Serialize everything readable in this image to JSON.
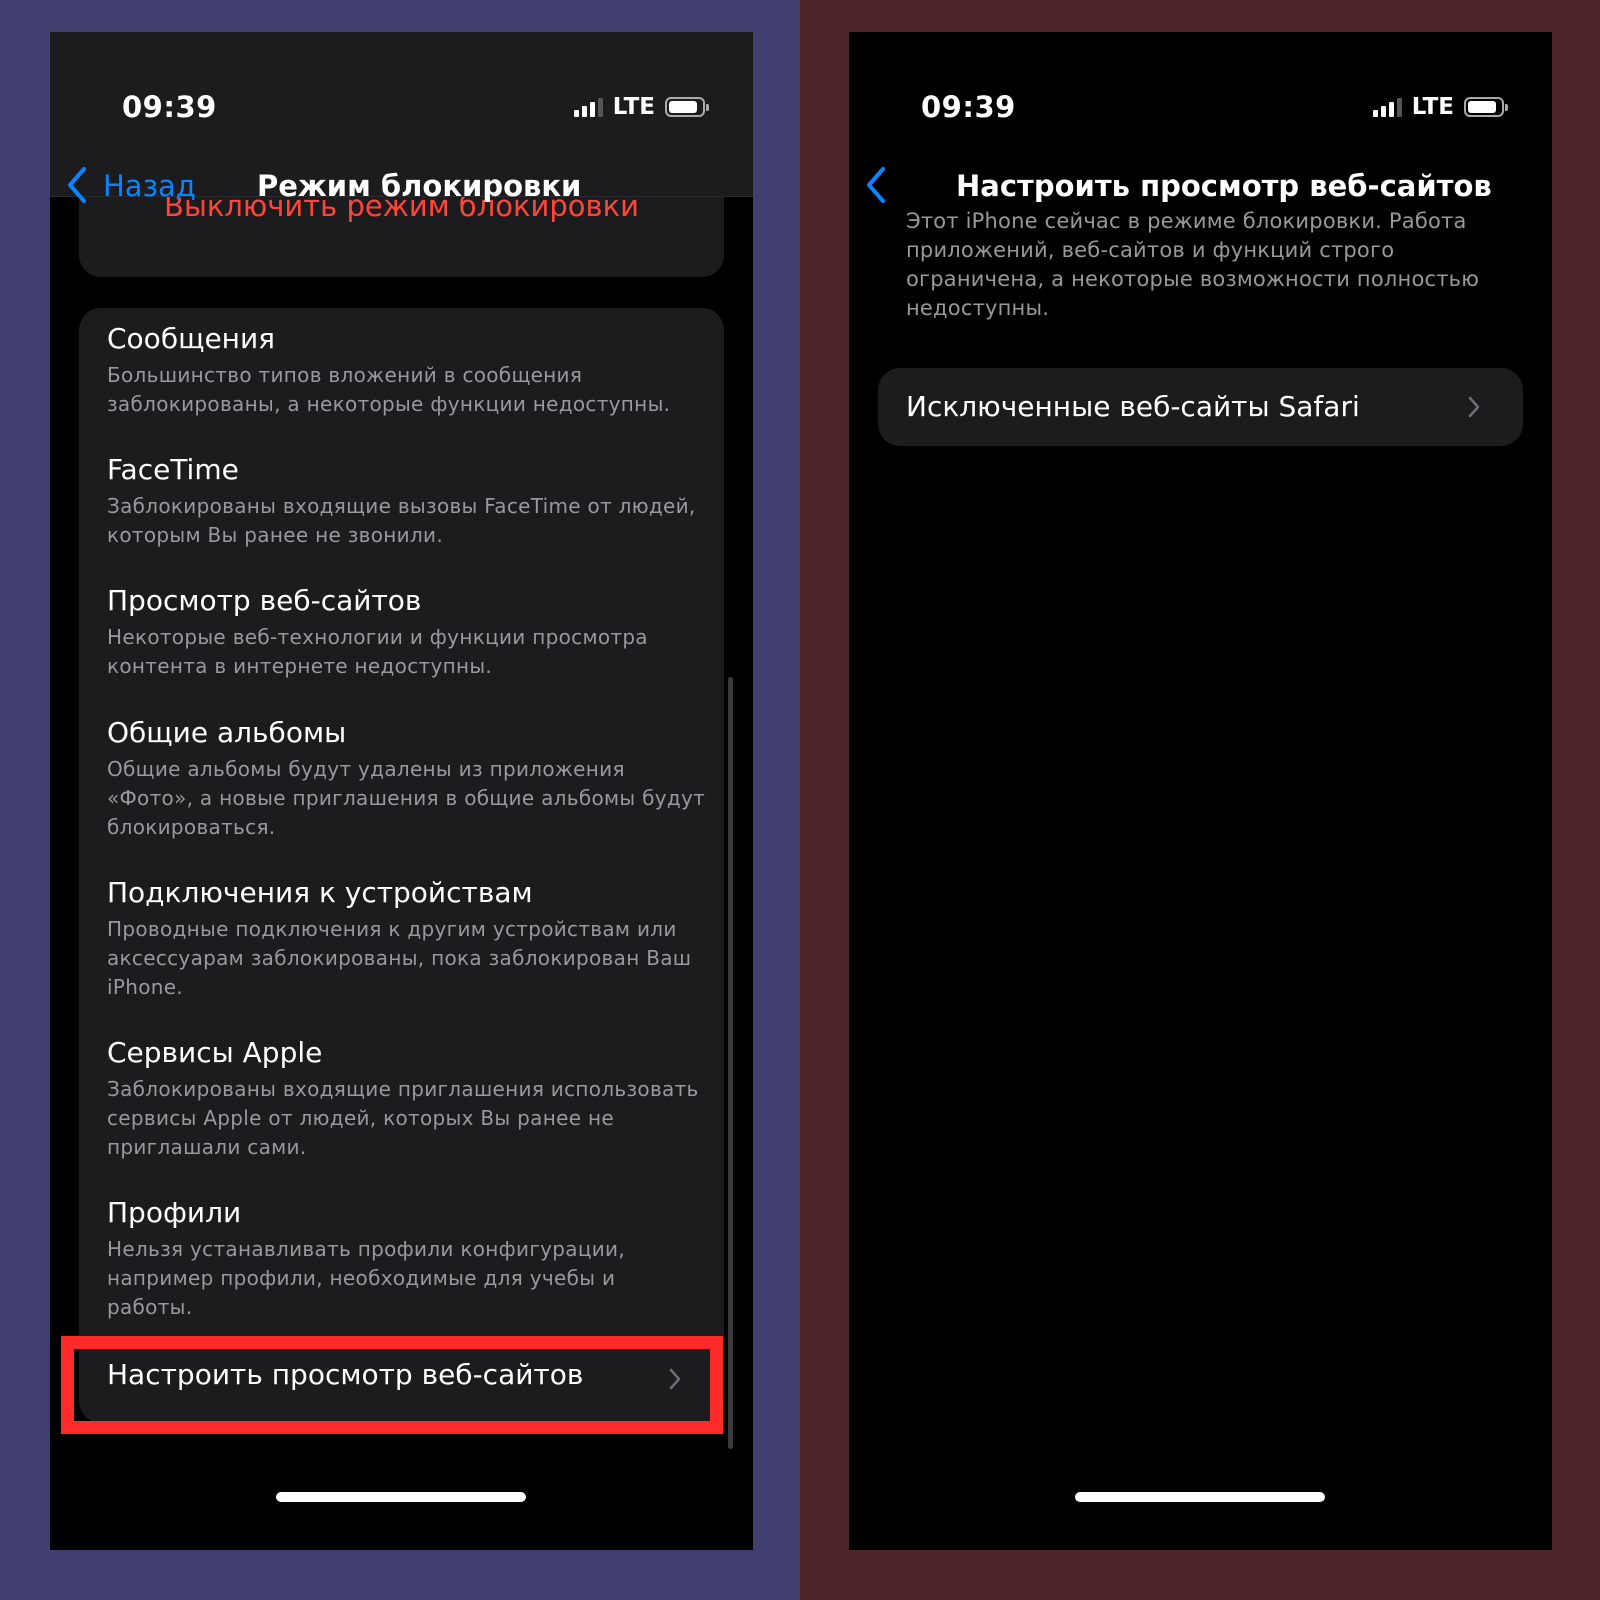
{
  "status_bar": {
    "time": "09:39",
    "network": "LTE"
  },
  "left_screen": {
    "back_label": "Назад",
    "title": "Режим блокировки",
    "disable_action": "Выключить режим блокировки",
    "items": [
      {
        "title": "Сообщения",
        "description": "Большинство типов вложений в сообщения заблокированы, а некоторые функции недоступны."
      },
      {
        "title": "FaceTime",
        "description": "Заблокированы входящие вызовы FaceTime от людей, которым Вы ранее не звонили."
      },
      {
        "title": "Просмотр веб-сайтов",
        "description": "Некоторые веб-технологии и функции просмотра контента в интернете недоступны."
      },
      {
        "title": "Общие альбомы",
        "description": "Общие альбомы будут удалены из приложения «Фото», а новые приглашения в общие альбомы будут блокироваться."
      },
      {
        "title": "Подключения к устройствам",
        "description": "Проводные подключения к другим устройствам или аксессуарам заблокированы, пока заблокирован Ваш iPhone."
      },
      {
        "title": "Сервисы Apple",
        "description": "Заблокированы входящие приглашения использовать сервисы Apple от людей, которых Вы ранее не приглашали сами."
      },
      {
        "title": "Профили",
        "description": "Нельзя устанавливать профили конфигурации, например профили, необходимые для учебы и работы."
      }
    ],
    "configure_row": "Настроить просмотр веб-сайтов"
  },
  "right_screen": {
    "title": "Настроить просмотр веб-сайтов",
    "info": "Этот iPhone сейчас в режиме блокировки. Работа приложений, веб-сайтов и функций строго ограничена, а некоторые возможности полностью недоступны.",
    "excluded_row": "Исключенные веб-сайты Safari"
  },
  "colors": {
    "accent": "#0a84ff",
    "destructive": "#ff453a",
    "highlight": "#ff2b2b"
  }
}
